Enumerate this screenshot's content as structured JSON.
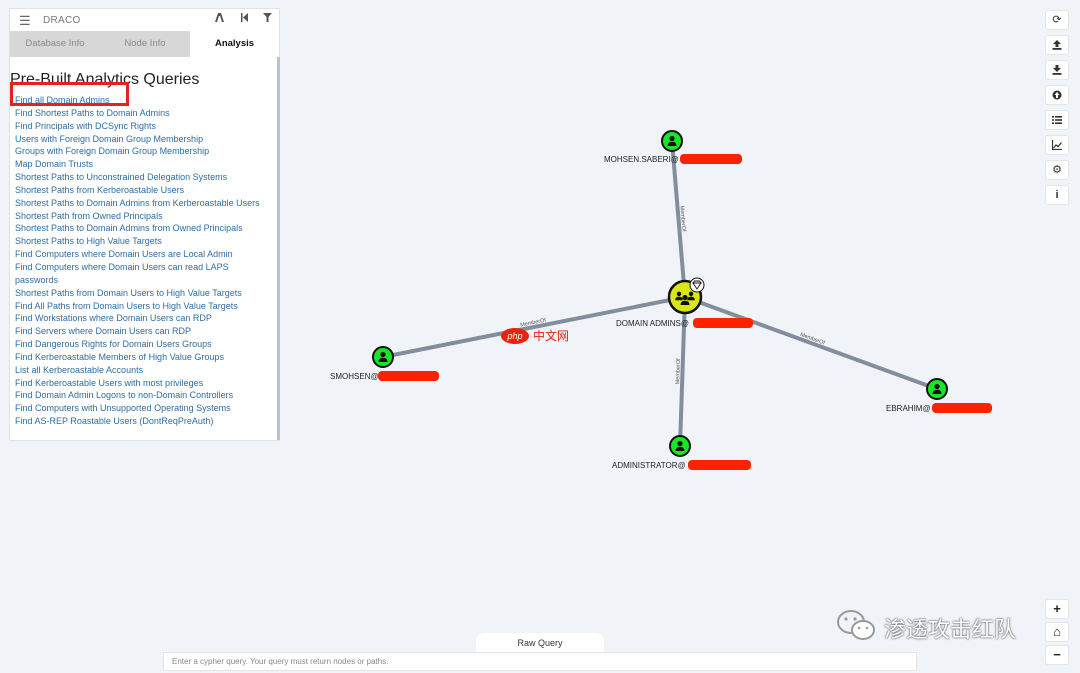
{
  "sidebar": {
    "db_name": "DRACO",
    "tabs": [
      {
        "label": "Database Info",
        "active": false
      },
      {
        "label": "Node Info",
        "active": false
      },
      {
        "label": "Analysis",
        "active": true
      }
    ],
    "heading": "Pre-Built Analytics Queries",
    "queries": [
      "Find all Domain Admins",
      "Find Shortest Paths to Domain Admins",
      "Find Principals with DCSync Rights",
      "Users with Foreign Domain Group Membership",
      "Groups with Foreign Domain Group Membership",
      "Map Domain Trusts",
      "Shortest Paths to Unconstrained Delegation Systems",
      "Shortest Paths from Kerberoastable Users",
      "Shortest Paths to Domain Admins from Kerberoastable Users",
      "Shortest Path from Owned Principals",
      "Shortest Paths to Domain Admins from Owned Principals",
      "Shortest Paths to High Value Targets",
      "Find Computers where Domain Users are Local Admin",
      "Find Computers where Domain Users can read LAPS",
      "passwords",
      "Shortest Paths from Domain Users to High Value Targets",
      "Find All Paths from Domain Users to High Value Targets",
      "Find Workstations where Domain Users can RDP",
      "Find Servers where Domain Users can RDP",
      "Find Dangerous Rights for Domain Users Groups",
      "Find Kerberoastable Members of High Value Groups",
      "List all Kerberoastable Accounts",
      "Find Kerberoastable Users with most privileges",
      "Find Domain Admin Logons to non-Domain Controllers",
      "Find Computers with Unsupported Operating Systems",
      "Find AS-REP Roastable Users (DontReqPreAuth)"
    ]
  },
  "graph": {
    "nodes": [
      {
        "id": "mohsen",
        "label": "MOHSEN.SABERI@",
        "type": "user"
      },
      {
        "id": "da",
        "label": "DOMAIN ADMINS@",
        "type": "group",
        "high_value": true
      },
      {
        "id": "smohsen",
        "label": "SMOHSEN@",
        "type": "user"
      },
      {
        "id": "ebrahim",
        "label": "EBRAHIM@",
        "type": "user"
      },
      {
        "id": "admin",
        "label": "ADMINISTRATOR@",
        "type": "user"
      }
    ],
    "edges": [
      {
        "from": "mohsen",
        "to": "da",
        "label": "MemberOf"
      },
      {
        "from": "smohsen",
        "to": "da",
        "label": "MemberOf"
      },
      {
        "from": "ebrahim",
        "to": "da",
        "label": "MemberOf"
      },
      {
        "from": "admin",
        "to": "da",
        "label": "MemberOf"
      }
    ],
    "colors": {
      "user_node": "#17e625",
      "group_node": "#dbe617",
      "edge": "#828e9d",
      "redaction": "#ff2200"
    }
  },
  "toolbar": {
    "icons": [
      "refresh-icon",
      "upload-icon",
      "download-icon",
      "upload-circle-icon",
      "list-icon",
      "chart-icon",
      "settings-icon",
      "info-icon"
    ]
  },
  "bottom": {
    "raw_query_label": "Raw Query",
    "cypher_placeholder": "Enter a cypher query. Your query must return nodes or paths."
  },
  "zoom": {
    "plus": "+",
    "home": "⌂",
    "minus": "−"
  },
  "watermark": {
    "text": "渗透攻击红队",
    "php_site": "php",
    "php_site_cn": "中文网"
  }
}
